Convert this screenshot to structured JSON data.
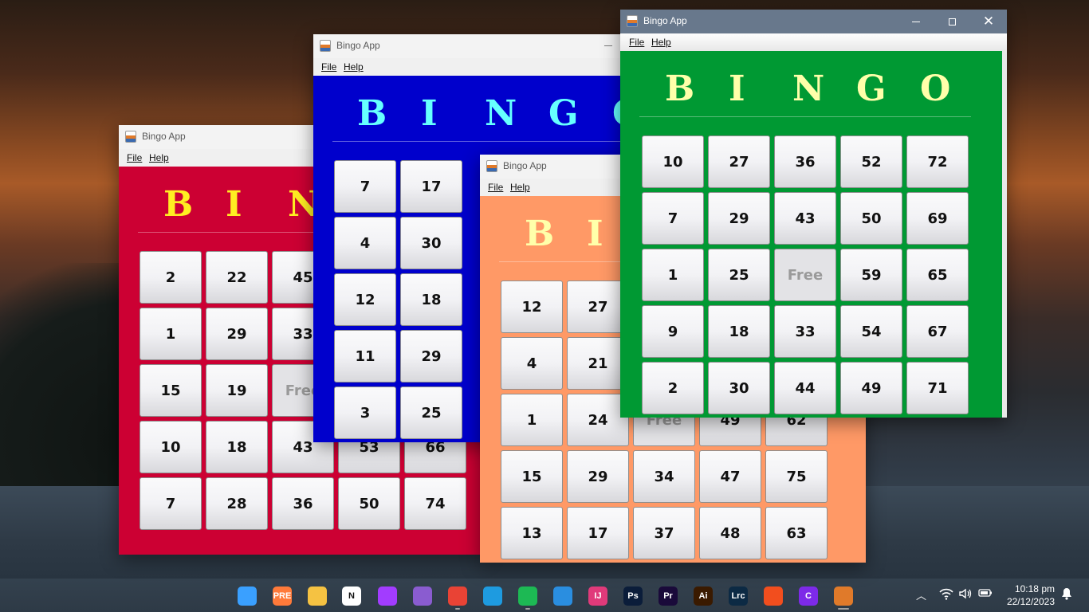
{
  "windows": {
    "red": {
      "title": "Bingo App",
      "menu": [
        "File",
        "Help"
      ],
      "header": [
        "B",
        "I",
        "N"
      ],
      "colors": {
        "bg": "#cc0033",
        "header": "#ffee22"
      },
      "rows": [
        [
          "2",
          "22",
          "45",
          "",
          ""
        ],
        [
          "1",
          "29",
          "33",
          "",
          ""
        ],
        [
          "15",
          "19",
          "Free",
          "",
          ""
        ],
        [
          "10",
          "18",
          "43",
          "53",
          "66"
        ],
        [
          "7",
          "28",
          "36",
          "50",
          "74"
        ]
      ]
    },
    "blue": {
      "title": "Bingo App",
      "menu": [
        "File",
        "Help"
      ],
      "header": [
        "B",
        "I",
        "N",
        "G",
        "O"
      ],
      "colors": {
        "bg": "#0000cc",
        "header": "#66ffff"
      },
      "rows": [
        [
          "7",
          "17"
        ],
        [
          "4",
          "30"
        ],
        [
          "12",
          "18"
        ],
        [
          "11",
          "29"
        ],
        [
          "3",
          "25"
        ]
      ]
    },
    "orange": {
      "title": "Bingo App",
      "menu": [
        "File",
        "Help"
      ],
      "header": [
        "B",
        "I"
      ],
      "colors": {
        "bg": "#ff9966",
        "header": "#ffffaa"
      },
      "rows": [
        [
          "12",
          "27",
          "",
          "",
          ""
        ],
        [
          "4",
          "21",
          "",
          "",
          ""
        ],
        [
          "1",
          "24",
          "Free",
          "49",
          "62"
        ],
        [
          "15",
          "29",
          "34",
          "47",
          "75"
        ],
        [
          "13",
          "17",
          "37",
          "48",
          "63"
        ]
      ]
    },
    "green": {
      "title": "Bingo App",
      "menu": [
        "File",
        "Help"
      ],
      "header": [
        "B",
        "I",
        "N",
        "G",
        "O"
      ],
      "colors": {
        "bg": "#009933",
        "header": "#ffffaa"
      },
      "rows": [
        [
          "10",
          "27",
          "36",
          "52",
          "72"
        ],
        [
          "7",
          "29",
          "43",
          "50",
          "69"
        ],
        [
          "1",
          "25",
          "Free",
          "59",
          "65"
        ],
        [
          "9",
          "18",
          "33",
          "54",
          "67"
        ],
        [
          "2",
          "30",
          "44",
          "49",
          "71"
        ]
      ]
    }
  },
  "taskbar": {
    "apps": [
      {
        "name": "start-icon",
        "label": "",
        "color": "#3aa0ff"
      },
      {
        "name": "copilot-pre-icon",
        "label": "PRE",
        "color": "#ff7a3a"
      },
      {
        "name": "file-explorer-icon",
        "label": "",
        "color": "#f5c242"
      },
      {
        "name": "notion-icon",
        "label": "N",
        "color": "#ffffff"
      },
      {
        "name": "messenger-icon",
        "label": "",
        "color": "#a23cff"
      },
      {
        "name": "github-icon",
        "label": "",
        "color": "#8a5cd0"
      },
      {
        "name": "chrome-icon",
        "label": "",
        "color": "#e94335"
      },
      {
        "name": "edge-icon",
        "label": "",
        "color": "#1e9be0"
      },
      {
        "name": "spotify-icon",
        "label": "",
        "color": "#1db954"
      },
      {
        "name": "vscode-icon",
        "label": "",
        "color": "#2a8ee0"
      },
      {
        "name": "intellij-icon",
        "label": "IJ",
        "color": "#e03a7a"
      },
      {
        "name": "photoshop-icon",
        "label": "Ps",
        "color": "#0b1d3a"
      },
      {
        "name": "premiere-icon",
        "label": "Pr",
        "color": "#1a0a3a"
      },
      {
        "name": "illustrator-icon",
        "label": "Ai",
        "color": "#3a1a00"
      },
      {
        "name": "lightroom-classic-icon",
        "label": "Lrc",
        "color": "#0c2a44"
      },
      {
        "name": "figma-icon",
        "label": "",
        "color": "#f24e1e"
      },
      {
        "name": "canva-icon",
        "label": "C",
        "color": "#7d2ae8"
      },
      {
        "name": "java-icon",
        "label": "",
        "color": "#e07a2a"
      }
    ],
    "clock": {
      "time": "10:18 pm",
      "date": "22/12/2023"
    }
  }
}
